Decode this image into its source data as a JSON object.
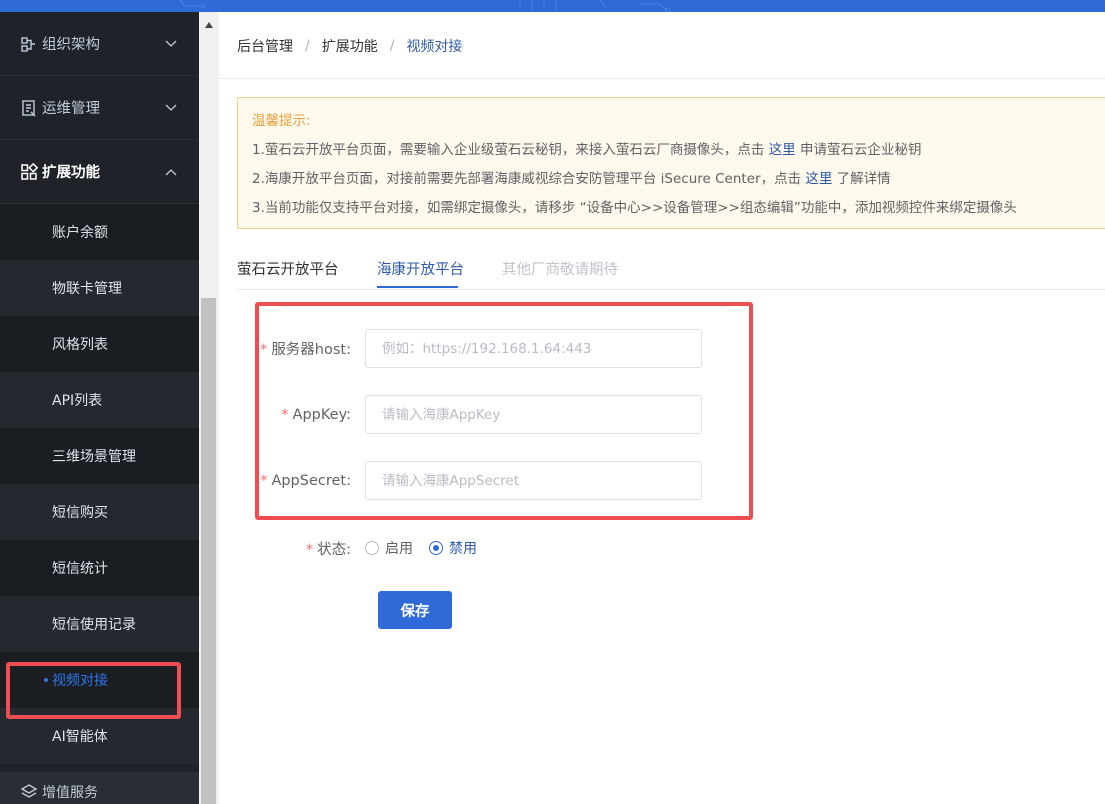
{
  "sidebar": {
    "groups": [
      {
        "label": "组织架构",
        "icon": "org-chart-icon"
      },
      {
        "label": "运维管理",
        "icon": "clipboard-icon"
      },
      {
        "label": "扩展功能",
        "icon": "grid-icon"
      }
    ],
    "items": [
      {
        "label": "账户余额"
      },
      {
        "label": "物联卡管理"
      },
      {
        "label": "风格列表"
      },
      {
        "label": "API列表"
      },
      {
        "label": "三维场景管理"
      },
      {
        "label": "短信购买"
      },
      {
        "label": "短信统计"
      },
      {
        "label": "短信使用记录"
      },
      {
        "label": "视频对接",
        "current": true
      },
      {
        "label": "AI智能体"
      }
    ],
    "bottom_label": "增值服务"
  },
  "breadcrumb": [
    "后台管理",
    "扩展功能",
    "视频对接"
  ],
  "notice": {
    "title": "温馨提示:",
    "line1_a": "1.萤石云开放平台页面，需要输入企业级萤石云秘钥，来接入萤石云厂商摄像头，点击",
    "line1_link": "这里",
    "line1_b": "申请萤石云企业秘钥",
    "line2_a": "2.海康开放平台页面，对接前需要先部署海康威视综合安防管理平台 iSecure Center，点击",
    "line2_link": "这里",
    "line2_b": "了解详情",
    "line3": "3.当前功能仅支持平台对接，如需绑定摄像头，请移步 “设备中心>>设备管理>>组态编辑”功能中，添加视频控件来绑定摄像头"
  },
  "tabs": [
    {
      "label": "萤石云开放平台"
    },
    {
      "label": "海康开放平台",
      "active": true
    },
    {
      "label": "其他厂商敬请期待",
      "disabled": true
    }
  ],
  "form": {
    "host_label": "服务器host:",
    "host_placeholder": "例如：https://192.168.1.64:443",
    "appkey_label": "AppKey:",
    "appkey_placeholder": "请输入海康AppKey",
    "appsecret_label": "AppSecret:",
    "appsecret_placeholder": "请输入海康AppSecret",
    "status_label": "状态:",
    "status_options": [
      "启用",
      "禁用"
    ],
    "status_selected": "禁用",
    "save_label": "保存"
  },
  "colors": {
    "accent": "#2f6ad8",
    "highlight": "#ee4d52",
    "sidebar_bg": "#1f2229"
  }
}
